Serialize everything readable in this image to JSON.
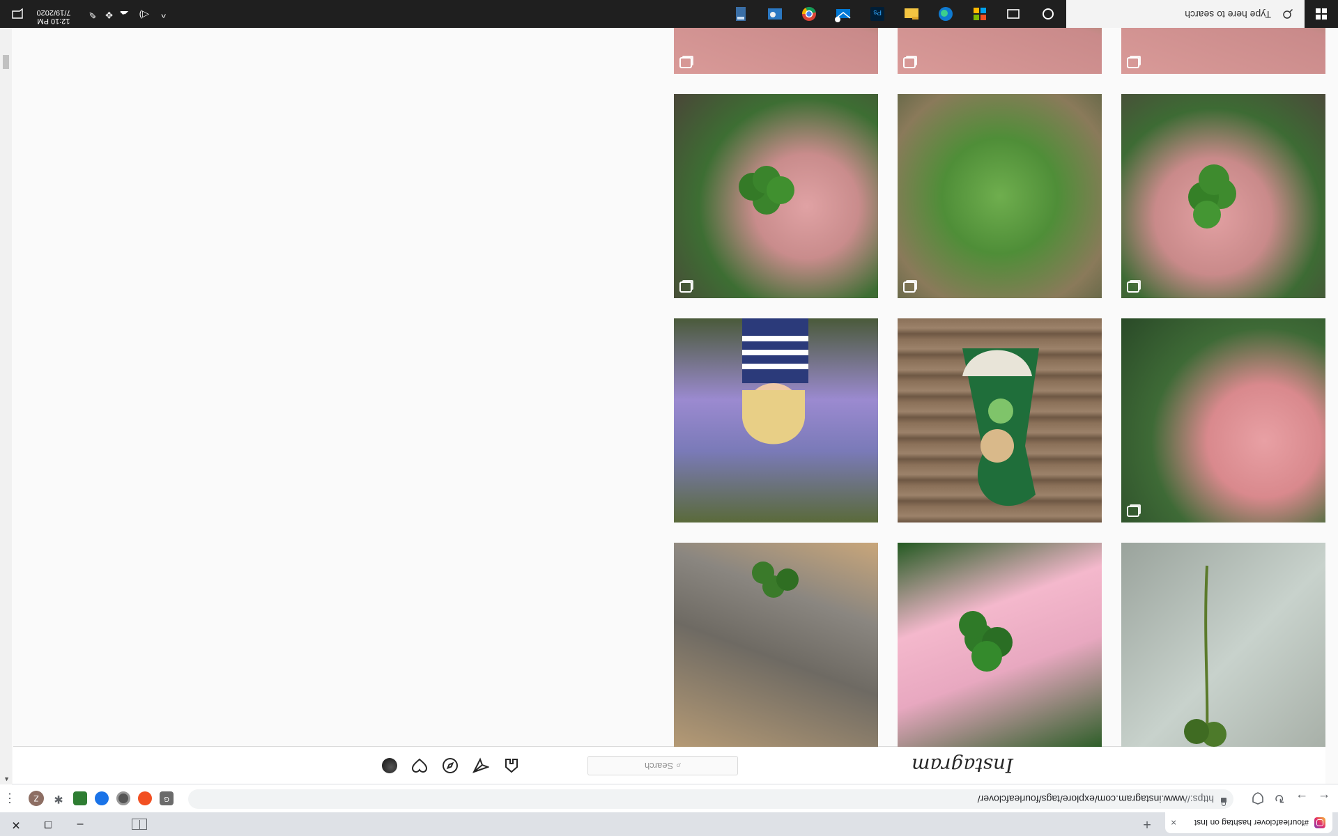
{
  "browser": {
    "tab_title": "#fourleafclover hashtag on Inst",
    "tab_close": "×",
    "new_tab": "+",
    "window_controls": {
      "minimize": "–",
      "maximize": "❐",
      "close": "✕"
    },
    "nav": {
      "back": "←",
      "forward": "→",
      "reload": "↻"
    },
    "url_scheme": "https://",
    "url_rest": "www.instagram.com/explore/tags/fourleafclover/",
    "profile_initial": "Z",
    "menu": "⋮"
  },
  "instagram": {
    "logo_text": "Instagram",
    "search_placeholder": "Search",
    "search_glyph": "⌕"
  },
  "scrollbar": {
    "up": "▲",
    "down": "▼"
  },
  "taskbar": {
    "search_placeholder": "Type here to search",
    "time": "12:10 PM",
    "date": "7/19/2020",
    "chevron": "^"
  }
}
